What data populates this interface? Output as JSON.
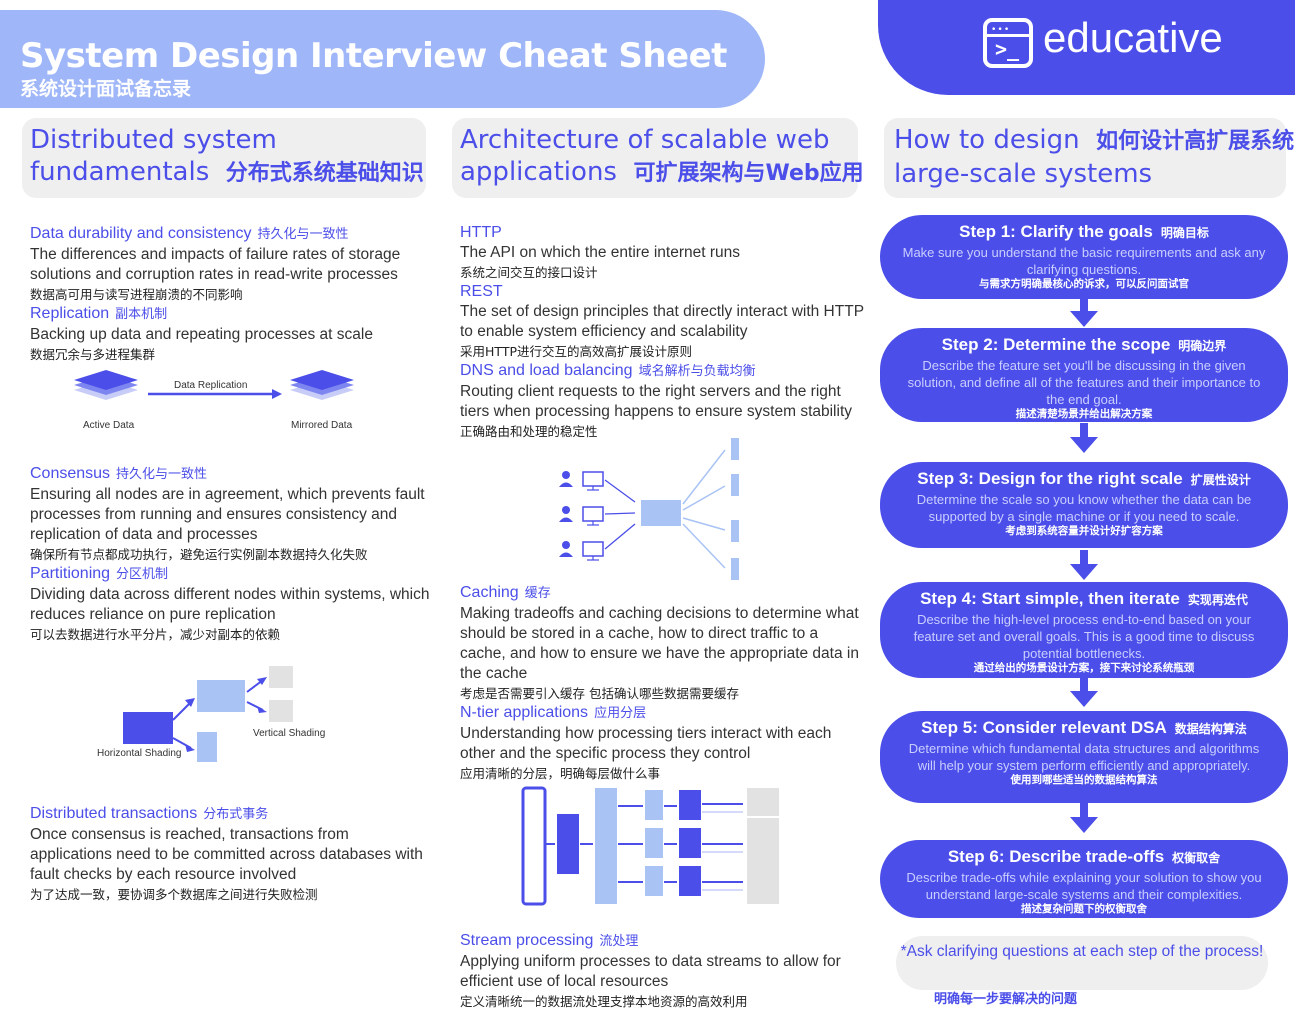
{
  "header": {
    "title": "System Design Interview Cheat Sheet",
    "title_cn": "系统设计面试备忘录",
    "brand": "educative",
    "brand_color": "#4b4ee8",
    "banner_color": "#9fb6f8"
  },
  "columns": [
    {
      "title_en_line1": "Distributed system",
      "title_en_line2": "fundamentals",
      "title_cn": "分布式系统基础知识"
    },
    {
      "title_en_line1": "Architecture of scalable web",
      "title_en_line2": "applications",
      "title_cn": "可扩展架构与Web应用"
    },
    {
      "title_en_line1": "How to design",
      "title_en_line2": "large-scale systems",
      "title_cn": "如何设计高扩展系统"
    }
  ],
  "col1": [
    {
      "title": "Data durability and consistency",
      "title_cn": "持久化与一致性",
      "body": "The differences and impacts of failure rates of storage solutions and corruption rates in read-write processes",
      "cn": "数据高可用与读写进程崩溃的不同影响"
    },
    {
      "title": "Replication",
      "title_cn": "副本机制",
      "body": "Backing up data and repeating processes at scale",
      "cn": "数据冗余与多进程集群"
    },
    {
      "title": "Consensus",
      "title_cn": "持久化与一致性",
      "body": "Ensuring all nodes are in agreement, which prevents fault processes from running and ensures consistency and replication of data and processes",
      "cn": "确保所有节点都成功执行，避免运行实例副本数据持久化失败"
    },
    {
      "title": "Partitioning",
      "title_cn": "分区机制",
      "body": "Dividing data across different nodes within systems, which reduces reliance on pure replication",
      "cn": "可以去数据进行水平分片，减少对副本的依赖"
    },
    {
      "title": "Distributed transactions",
      "title_cn": "分布式事务",
      "body": "Once consensus is reached, transactions from applications need to be committed across databases with fault checks by each resource involved",
      "cn": "为了达成一致，要协调多个数据库之间进行失败检测"
    }
  ],
  "col2": [
    {
      "title": "HTTP",
      "title_cn": "",
      "body": "The API on which the entire internet runs",
      "cn": "系统之间交互的接口设计"
    },
    {
      "title": "REST",
      "title_cn": "",
      "body": "The set of design principles that directly interact with HTTP to enable system efficiency and scalability",
      "cn": "采用HTTP进行交互的高效高扩展设计原则"
    },
    {
      "title": "DNS and load balancing",
      "title_cn": "域名解析与负载均衡",
      "body": "Routing client requests to the right servers and the right tiers when processing happens to ensure system stability",
      "cn": "正确路由和处理的稳定性"
    },
    {
      "title": "Caching",
      "title_cn": "缓存",
      "body": "Making tradeoffs and caching decisions to determine what should be stored in a cache, how to direct traffic to a cache, and how to ensure we have the appropriate data in the cache",
      "cn": "考虑是否需要引入缓存 包括确认哪些数据需要缓存"
    },
    {
      "title": "N-tier applications",
      "title_cn": "应用分层",
      "body": "Understanding how processing tiers interact with each other and the specific process they control",
      "cn": "应用清晰的分层，明确每层做什么事"
    },
    {
      "title": "Stream processing",
      "title_cn": "流处理",
      "body": "Applying uniform processes to data streams to allow for efficient use of local resources",
      "cn": "定义清晰统一的数据流处理支撑本地资源的高效利用"
    }
  ],
  "diagrams": {
    "replication": {
      "arrow_label": "Data Replication",
      "left_label": "Active Data",
      "right_label": "Mirrored Data"
    },
    "partitioning": {
      "vertical_label": "Vertical Shading",
      "horizontal_label": "Horizontal Shading"
    }
  },
  "steps": [
    {
      "title": "Step 1: Clarify the goals",
      "title_cn": "明确目标",
      "desc": "Make sure you understand the basic requirements and ask any clarifying questions.",
      "cn": "与需求方明确最核心的诉求，可以反问面试官"
    },
    {
      "title": "Step 2: Determine the scope",
      "title_cn": "明确边界",
      "desc": "Describe the feature set you'll be discussing in the given solution, and define all of the features and their importance to the end goal.",
      "cn": "描述清楚场景并给出解决方案"
    },
    {
      "title": "Step 3: Design for the right scale",
      "title_cn": "扩展性设计",
      "desc": "Determine the scale so you know whether the data can be supported by a single machine or if you need to scale.",
      "cn": "考虑到系统容量并设计好扩容方案"
    },
    {
      "title": "Step 4: Start simple, then iterate",
      "title_cn": "实现再迭代",
      "desc": "Describe the high-level process end-to-end based on your feature set and overall goals. This is a good time to discuss potential bottlenecks.",
      "cn": "通过给出的场景设计方案，接下来讨论系统瓶颈"
    },
    {
      "title": "Step 5: Consider relevant DSA",
      "title_cn": "数据结构算法",
      "desc": "Determine which fundamental data structures and algorithms will help your system perform efficiently and appropriately.",
      "cn": "使用到哪些适当的数据结构算法"
    },
    {
      "title": "Step 6: Describe trade-offs",
      "title_cn": "权衡取舍",
      "desc": "Describe trade-offs while explaining your solution to show you understand large-scale systems and their complexities.",
      "cn": "描述复杂问题下的权衡取舍"
    }
  ],
  "ask": {
    "text": "*Ask clarifying questions at each step of the process!",
    "cn": "明确每一步要解决的问题"
  }
}
